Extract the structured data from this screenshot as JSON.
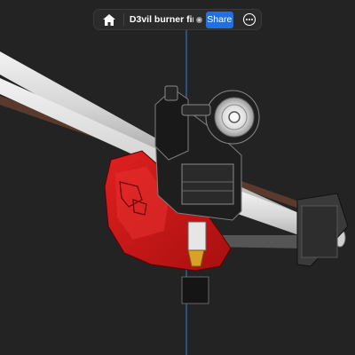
{
  "toolbar": {
    "home_icon": "home-icon",
    "document_title": "D3vil burner final...",
    "sync_icon": "sync-status-icon",
    "share_label": "Share",
    "more_icon": "more-options-icon"
  },
  "viewport": {
    "background": "#232323",
    "axis_color": "#3b7bd9",
    "model_color": "#d21a1a",
    "rod_color": "#d9d9d9"
  }
}
